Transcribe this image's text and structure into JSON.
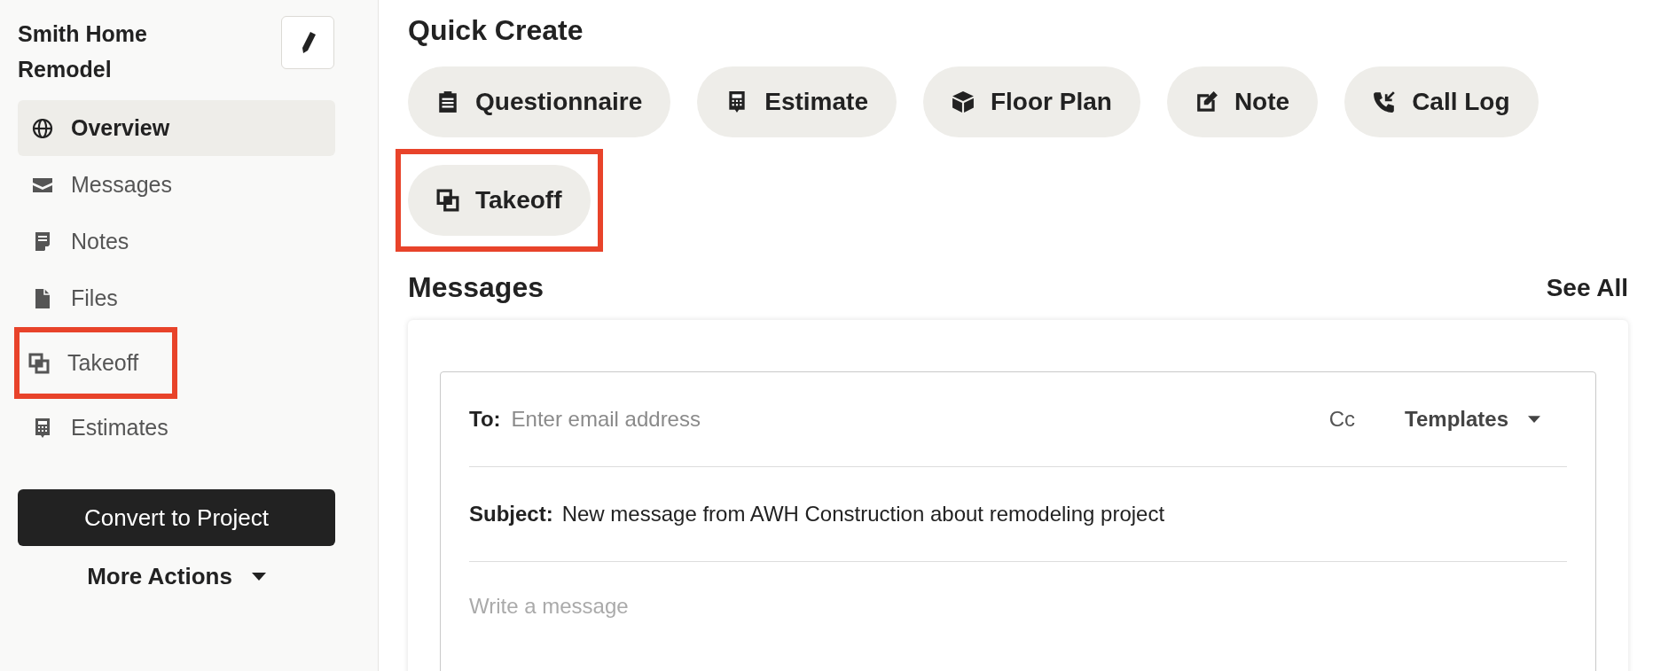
{
  "sidebar": {
    "title": "Smith Home Remodel",
    "items": [
      {
        "label": "Overview",
        "selected": true,
        "highlighted": false
      },
      {
        "label": "Messages",
        "selected": false,
        "highlighted": false
      },
      {
        "label": "Notes",
        "selected": false,
        "highlighted": false
      },
      {
        "label": "Files",
        "selected": false,
        "highlighted": false
      },
      {
        "label": "Takeoff",
        "selected": false,
        "highlighted": true
      },
      {
        "label": "Estimates",
        "selected": false,
        "highlighted": false
      }
    ],
    "primary_button": "Convert to Project",
    "more_actions": "More Actions"
  },
  "quick_create": {
    "title": "Quick Create",
    "items": [
      {
        "label": "Questionnaire",
        "highlighted": false
      },
      {
        "label": "Estimate",
        "highlighted": false
      },
      {
        "label": "Floor Plan",
        "highlighted": false
      },
      {
        "label": "Note",
        "highlighted": false
      },
      {
        "label": "Call Log",
        "highlighted": false
      },
      {
        "label": "Takeoff",
        "highlighted": true
      }
    ]
  },
  "messages": {
    "title": "Messages",
    "see_all": "See All",
    "composer": {
      "to_label": "To:",
      "to_placeholder": "Enter email address",
      "cc": "Cc",
      "templates": "Templates",
      "subject_label": "Subject:",
      "subject": "New message from AWH Construction about remodeling project",
      "body_placeholder": "Write a message"
    }
  }
}
